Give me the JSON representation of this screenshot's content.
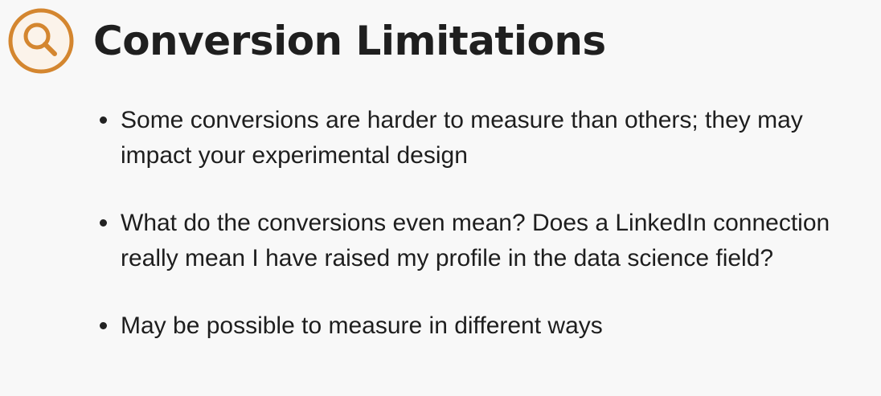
{
  "slide": {
    "title": "Conversion Limitations",
    "title_icon": "magnifier-icon",
    "accent_color": "#d4862f",
    "bullets": [
      {
        "text": "Some conversions are harder to measure than others; they may impact your experimental design"
      },
      {
        "text": "What do the conversions even mean? Does a LinkedIn connection really mean I have raised my profile in the data science field?"
      },
      {
        "text": "May be possible to measure in different ways"
      }
    ]
  }
}
